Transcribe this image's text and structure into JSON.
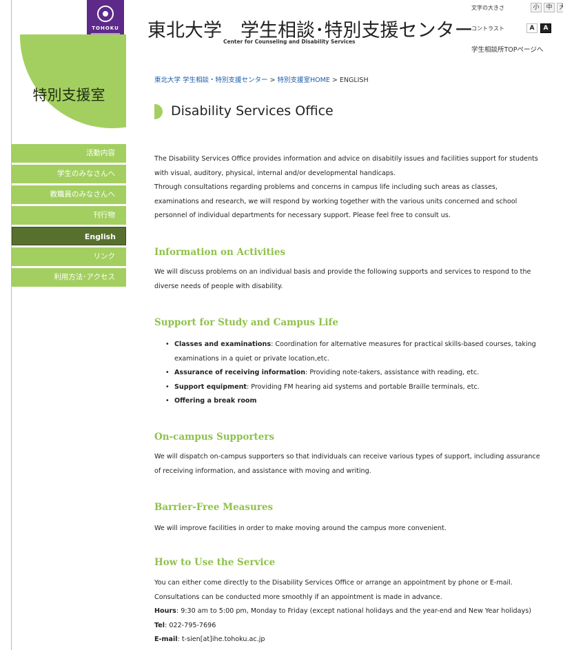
{
  "header": {
    "logo_text": "TOHOKU",
    "title": "東北大学　学生相談･特別支援センター",
    "subtitle": "Center for Counseling and Disability Services",
    "font_size_label": "文字の大きさ",
    "font_size_options": [
      "小",
      "中",
      "大"
    ],
    "contrast_label": "コントラスト",
    "contrast_options": [
      "A",
      "A"
    ],
    "top_link": "学生相談所TOPページへ"
  },
  "sidebar": {
    "section_title": "特別支援室",
    "items": [
      {
        "label": "活動内容"
      },
      {
        "label": "学生のみなさんへ"
      },
      {
        "label": "教職員のみなさんへ"
      },
      {
        "label": "刊行物"
      },
      {
        "label": "English"
      },
      {
        "label": "リンク"
      },
      {
        "label": "利用方法･アクセス"
      }
    ]
  },
  "breadcrumb": {
    "link1": "東北大学 学生相談・特別支援センター",
    "sep": " > ",
    "link2": "特別支援室HOME",
    "current": "ENGLISH"
  },
  "page": {
    "title": "Disability Services Office",
    "intro": [
      "The Disability Services Office provides information and advice on disabitily issues and facilities support for students",
      "with visual, auditory, physical, internal and/or developmental handicaps.",
      "Through consultations regarding problems and concerns in campus life including such areas as classes,",
      "examinations and research, we will respond by working together with the various units concerned and school",
      "personnel of individual departments for necessary support. Please feel free to consult us."
    ],
    "sections": {
      "activities": {
        "heading": "Information on Activities",
        "lines": [
          "We will discuss problems on an individual basis and provide the following supports and services to respond to the",
          "diverse needs of people with disability."
        ]
      },
      "support": {
        "heading": "Support for Study and Campus Life",
        "items": [
          {
            "bold": "Classes and examinations",
            "text": ": Coordination for alternative measures for practical skills-based courses, taking",
            "text2": "examinations in a quiet or private location,etc."
          },
          {
            "bold": "Assurance of receiving information",
            "text": ": Providing note-takers, assistance with reading, etc."
          },
          {
            "bold": "Support equipment",
            "text": ": Providing FM hearing aid systems and portable Braille terminals, etc."
          },
          {
            "bold": "Offering a break room",
            "text": ""
          }
        ]
      },
      "supporters": {
        "heading": "On-campus Supporters",
        "lines": [
          "We will dispatch on-campus supporters so that individuals can receive various types of support, including assurance",
          "of receiving information, and assistance with moving and writing."
        ]
      },
      "barrier": {
        "heading": "Barrier-Free Measures",
        "lines": [
          "We will improve facilities in order to make moving around the campus more convenient."
        ]
      },
      "howto": {
        "heading": "How to Use the Service",
        "lines": [
          "You can either come directly to the Disability Services Office or arrange an appointment by phone or E-mail.",
          "Consultations can be conducted more smoothly if an appointment is made in advance."
        ],
        "hours_label": "Hours",
        "hours_value": ": 9:30 am to 5:00 pm, Monday to Friday (except national holidays and the year-end and New Year holidays)",
        "tel_label": "Tel",
        "tel_value": ": 022-795-7696",
        "email_label": "E-mail",
        "email_value": ": t-sien[at]ihe.tohoku.ac.jp"
      }
    }
  },
  "colors": {
    "accent_green": "#a3cf60",
    "active_nav": "#58702e",
    "heading_green": "#8fc14c",
    "logo_purple": "#5d2a8a",
    "link_blue": "#1a5aa8"
  }
}
